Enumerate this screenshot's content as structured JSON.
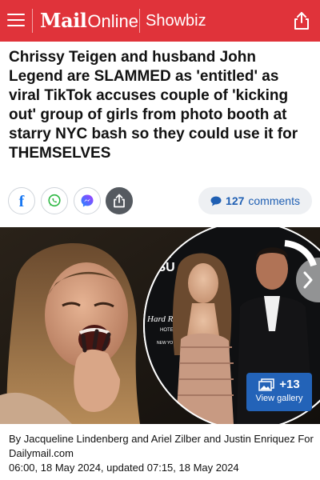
{
  "header": {
    "logo_mail": "Mail",
    "logo_online": "Online",
    "section": "Showbiz",
    "background": "#e0333a"
  },
  "article": {
    "headline": "Chrissy Teigen and husband John Legend are SLAMMED as 'entitled' as viral TikTok accuses couple of 'kicking out' group of girls from photo booth at starry NYC bash so they could use it for THEMSELVES",
    "byline": "By Jacqueline Lindenberg and Ariel Zilber and Justin Enriquez For Dailymail.com",
    "timestamp": "06:00, 18 May 2024, updated 07:15, 18 May 2024"
  },
  "social": {
    "facebook_icon": "f",
    "comments_count": "127",
    "comments_label": "comments",
    "accent": "#1f5fb3"
  },
  "gallery": {
    "count": "+13",
    "label": "View gallery",
    "badge_color": "#2363b8"
  },
  "photo": {
    "backdrop_text_1": "Hard Rock",
    "backdrop_text_2": "HOTEL",
    "backdrop_text_3": "NEW YO"
  }
}
